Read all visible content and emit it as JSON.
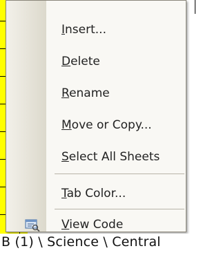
{
  "menu": {
    "items": [
      {
        "pre": "",
        "accel": "I",
        "post": "nsert..."
      },
      {
        "pre": "",
        "accel": "D",
        "post": "elete"
      },
      {
        "pre": "",
        "accel": "R",
        "post": "ename"
      },
      {
        "pre": "",
        "accel": "M",
        "post": "ove or Copy..."
      },
      {
        "pre": "",
        "accel": "S",
        "post": "elect All Sheets"
      },
      {
        "pre": "",
        "accel": "T",
        "post": "ab Color..."
      },
      {
        "pre": "",
        "accel": "V",
        "post": "iew Code"
      }
    ],
    "icons": {
      "view_code": "view-code-icon"
    }
  },
  "tabs": {
    "text": "B (1) \\ Science \\ Central"
  },
  "colors": {
    "sheet_fill": "#ffff00",
    "menu_bg": "#f9f8f4"
  }
}
